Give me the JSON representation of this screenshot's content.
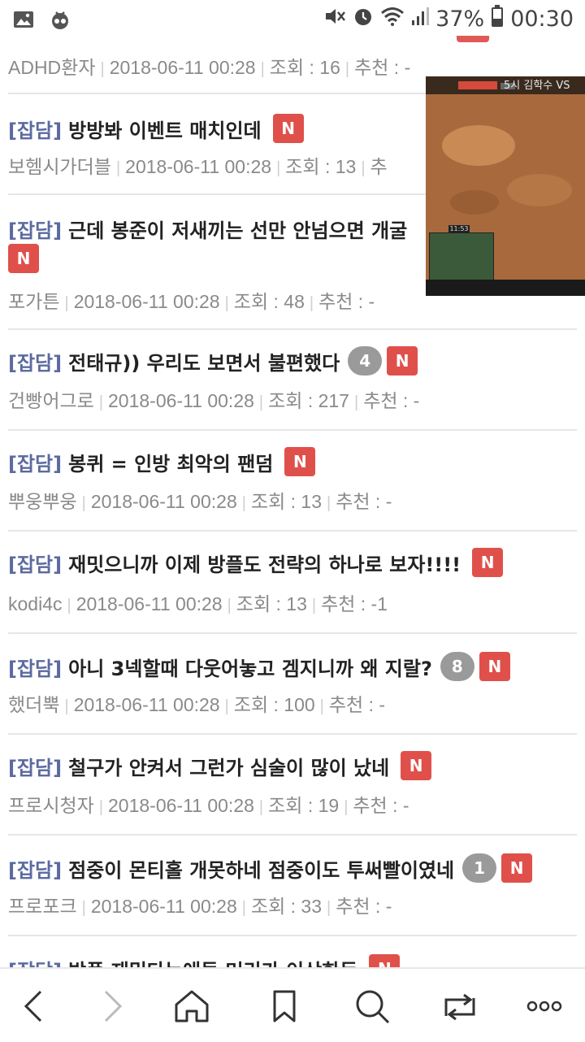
{
  "status_bar": {
    "battery": "37%",
    "time": "00:30",
    "icons": [
      "image-icon",
      "bot-icon",
      "mute-icon",
      "alarm-icon",
      "wifi-icon",
      "signal-icon",
      "battery-icon"
    ]
  },
  "colors": {
    "category": "#5c6aa0",
    "new_badge": "#e0504b",
    "comment_badge": "#9a9a9a",
    "meta_text": "#8a8a8a"
  },
  "partial_top": {
    "author": "ADHD환자",
    "date": "2018-06-11 00:28",
    "views": "조회 : 16",
    "recommend": "추천 : -"
  },
  "posts": [
    {
      "category": "[잡담]",
      "title": "방방봐 이벤트 매치인데",
      "comments": "",
      "badge": "N",
      "author": "보헴시가더블",
      "date": "2018-06-11 00:28",
      "views": "조회 : 13",
      "recommend": "추"
    },
    {
      "category": "[잡담]",
      "title": "근데 봉준이 저새끼는 선만 안넘으면 개굴",
      "comments": "",
      "badge": "N",
      "author": "포가튼",
      "date": "2018-06-11 00:28",
      "views": "조회 : 48",
      "recommend": "추천 : -"
    },
    {
      "category": "[잡담]",
      "title": "전태규)) 우리도 보면서 불편했다",
      "comments": "4",
      "badge": "N",
      "author": "건빵어그로",
      "date": "2018-06-11 00:28",
      "views": "조회 : 217",
      "recommend": "추천 : -"
    },
    {
      "category": "[잡담]",
      "title": "봉퀴 = 인방 최악의 팬덤",
      "comments": "",
      "badge": "N",
      "author": "뿌웅뿌웅",
      "date": "2018-06-11 00:28",
      "views": "조회 : 13",
      "recommend": "추천 : -"
    },
    {
      "category": "[잡담]",
      "title": "재밋으니까 이제 방플도 전략의 하나로 보자!!!!",
      "comments": "",
      "badge": "N",
      "author": "kodi4c",
      "date": "2018-06-11 00:28",
      "views": "조회 : 13",
      "recommend": "추천 : -1"
    },
    {
      "category": "[잡담]",
      "title": "아니 3넥할때 다웃어놓고 겜지니까 왜 지랄?",
      "comments": "8",
      "badge": "N",
      "author": "했더뿍",
      "date": "2018-06-11 00:28",
      "views": "조회 : 100",
      "recommend": "추천 : -"
    },
    {
      "category": "[잡담]",
      "title": "철구가 안켜서 그런가 심술이 많이 났네",
      "comments": "",
      "badge": "N",
      "author": "프로시청자",
      "date": "2018-06-11 00:28",
      "views": "조회 : 19",
      "recommend": "추천 : -"
    },
    {
      "category": "[잡담]",
      "title": "점중이 몬티홀 개못하네 점중이도 투써빨이였네",
      "comments": "1",
      "badge": "N",
      "author": "프로포크",
      "date": "2018-06-11 00:28",
      "views": "조회 : 33",
      "recommend": "추천 : -"
    },
    {
      "category": "[잡담]",
      "title": "방플 재밌다는애들 머리가 이상한듯",
      "comments": "",
      "badge": "N",
      "author": "",
      "date": "",
      "views": "",
      "recommend": ""
    }
  ],
  "video_overlay": {
    "caption": "5시 김학수 VS",
    "clock": "11:53"
  },
  "bottom_nav": [
    "back-icon",
    "forward-icon",
    "home-icon",
    "bookmark-icon",
    "search-icon",
    "tabs-icon",
    "more-icon"
  ]
}
